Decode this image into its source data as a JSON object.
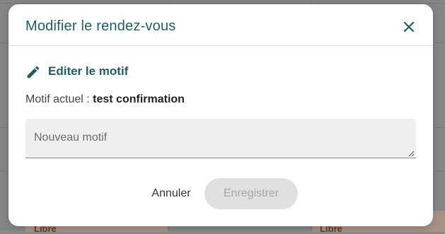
{
  "background": {
    "cell_labels": [
      "Libre",
      "Libre"
    ]
  },
  "modal": {
    "title": "Modifier le rendez-vous",
    "close_icon": "close-icon",
    "section": {
      "icon": "pencil-icon",
      "title": "Editer le motif"
    },
    "current_reason": {
      "label": "Motif actuel :",
      "value": "test confirmation"
    },
    "new_reason": {
      "placeholder": "Nouveau motif",
      "value": ""
    },
    "actions": {
      "cancel_label": "Annuler",
      "save_label": "Enregistrer",
      "save_enabled": false
    }
  },
  "colors": {
    "accent": "#1f5e60",
    "overlay": "#858585",
    "field_background": "#efefef",
    "disabled_button": "#e0e0e0",
    "disabled_text": "#a6a6a6"
  }
}
